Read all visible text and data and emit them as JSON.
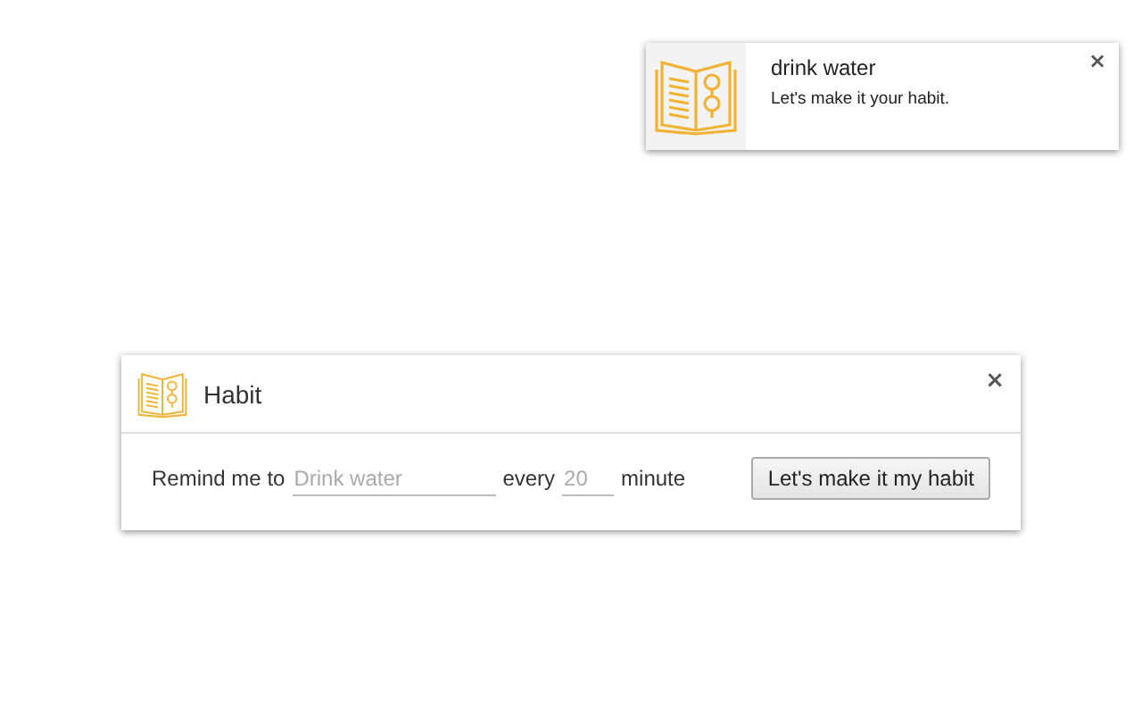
{
  "notification": {
    "title": "drink water",
    "message": "Let's make it your habit.",
    "close": "×"
  },
  "dialog": {
    "title": "Habit",
    "close": "×",
    "form": {
      "label": "Remind me to",
      "task_field": {
        "placeholder": "Drink water"
      },
      "every_label": "every",
      "interval_field": {
        "placeholder": "20"
      },
      "unit_label": "minute",
      "submit": "Let's make it my habit"
    }
  }
}
